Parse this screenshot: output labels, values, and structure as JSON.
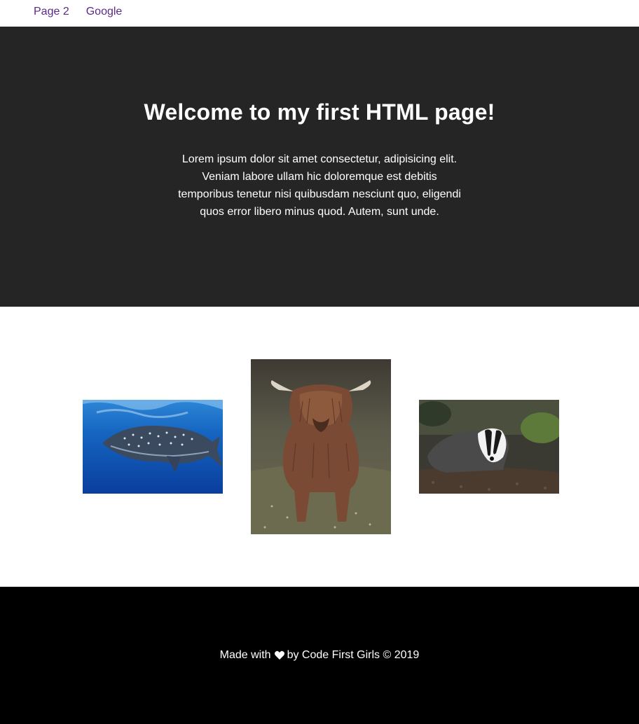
{
  "nav": {
    "links": [
      {
        "label": "Page 2"
      },
      {
        "label": "Google"
      }
    ],
    "link_color": "#5b2a86"
  },
  "hero": {
    "title": "Welcome to my first HTML page!",
    "body": "Lorem ipsum dolor sit amet consectetur, adipisicing elit. Veniam labore ullam hic doloremque est debitis temporibus tenetur nisi quibusdam nesciunt quo, eligendi quos error libero minus quod. Autem, sunt unde.",
    "background": "#252525"
  },
  "gallery": {
    "images": [
      {
        "subject": "whale shark underwater",
        "icon": "whale-shark-photo"
      },
      {
        "subject": "highland cow",
        "icon": "highland-cow-photo"
      },
      {
        "subject": "badger",
        "icon": "badger-photo"
      }
    ]
  },
  "footer": {
    "text_before": "Made with",
    "icon": "heart-icon",
    "text_after": "by Code First Girls © 2019",
    "background": "#000000"
  }
}
